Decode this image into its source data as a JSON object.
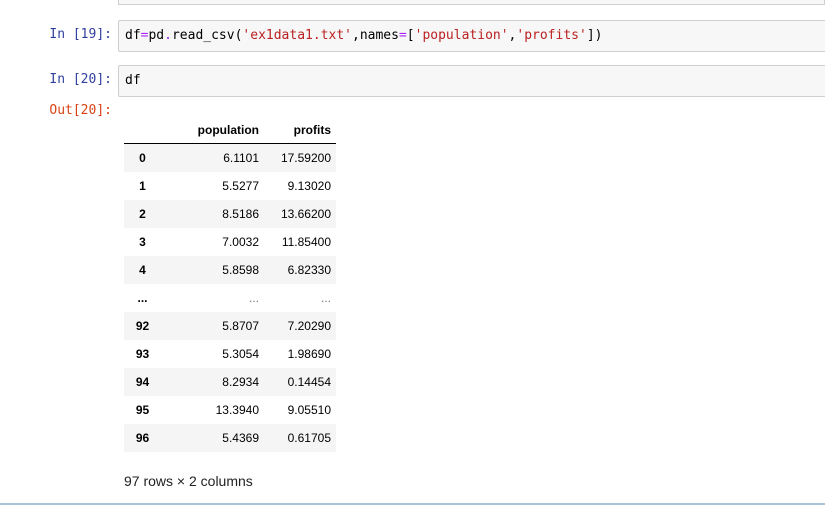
{
  "cells": [
    {
      "in_prompt": "In  [19]:",
      "code_tokens": [
        {
          "t": "df",
          "c": ""
        },
        {
          "t": "=",
          "c": "op"
        },
        {
          "t": "pd",
          "c": ""
        },
        {
          "t": ".",
          "c": "op"
        },
        {
          "t": "read_csv(",
          "c": ""
        },
        {
          "t": "'ex1data1.txt'",
          "c": "str"
        },
        {
          "t": ",",
          "c": ""
        },
        {
          "t": "names",
          "c": ""
        },
        {
          "t": "=",
          "c": "op"
        },
        {
          "t": "[",
          "c": ""
        },
        {
          "t": "'population'",
          "c": "str"
        },
        {
          "t": ",",
          "c": ""
        },
        {
          "t": "'profits'",
          "c": "str"
        },
        {
          "t": "])",
          "c": ""
        }
      ]
    },
    {
      "in_prompt": "In  [20]:",
      "code_tokens": [
        {
          "t": "df",
          "c": ""
        }
      ],
      "out_prompt": "Out[20]:"
    }
  ],
  "dataframe": {
    "columns": [
      "",
      "population",
      "profits"
    ],
    "rows": [
      [
        "0",
        "6.1101",
        "17.59200"
      ],
      [
        "1",
        "5.5277",
        "9.13020"
      ],
      [
        "2",
        "8.5186",
        "13.66200"
      ],
      [
        "3",
        "7.0032",
        "11.85400"
      ],
      [
        "4",
        "5.8598",
        "6.82330"
      ],
      [
        "...",
        "...",
        "..."
      ],
      [
        "92",
        "5.8707",
        "7.20290"
      ],
      [
        "93",
        "5.3054",
        "1.98690"
      ],
      [
        "94",
        "8.2934",
        "0.14454"
      ],
      [
        "95",
        "13.3940",
        "9.05510"
      ],
      [
        "96",
        "5.4369",
        "0.61705"
      ]
    ],
    "shape_text": "97 rows × 2 columns"
  },
  "colors": {
    "in_prompt": "#303f9f",
    "out_prompt": "#d84315",
    "string": "#ba2121",
    "operator": "#aa22ff",
    "input_bg": "#f7f7f7"
  }
}
